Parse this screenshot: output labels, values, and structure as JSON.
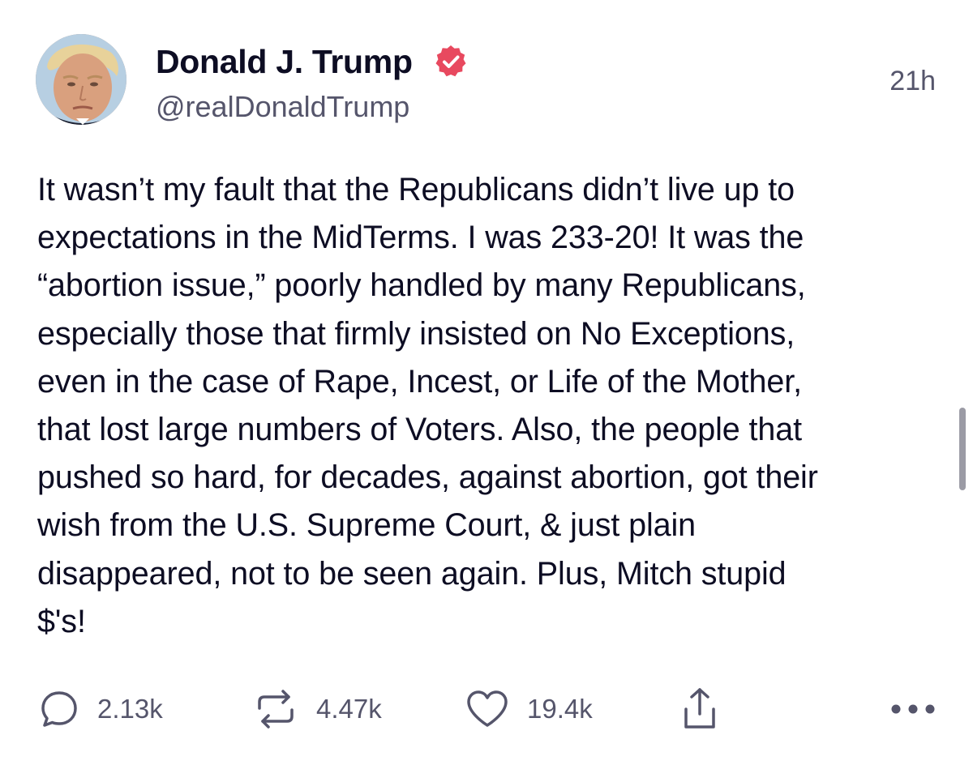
{
  "author": {
    "display_name": "Donald J. Trump",
    "handle": "@realDonaldTrump",
    "verified": true,
    "avatar_icon": "profile-photo"
  },
  "timestamp": "21h",
  "body": "It wasn’t my fault that the Republicans didn’t live up to\nexpectations in the MidTerms. I was 233-20! It was the\n“abortion issue,” poorly handled by many Republicans,\nespecially those that firmly insisted on No Exceptions,\neven in the case of Rape, Incest, or Life of the Mother,\nthat lost large numbers of Voters. Also, the people that\npushed so hard, for decades, against abortion, got their\nwish from the U.S. Supreme Court, & just plain\ndisappeared, not to be seen again. Plus, Mitch stupid\n$'s!",
  "actions": {
    "reply": {
      "icon": "reply-bubble-icon",
      "count": "2.13k"
    },
    "repost": {
      "icon": "repost-arrows-icon",
      "count": "4.47k"
    },
    "like": {
      "icon": "heart-icon",
      "count": "19.4k"
    },
    "share": {
      "icon": "share-upload-icon"
    },
    "more": {
      "icon": "more-dots-icon"
    }
  },
  "colors": {
    "text_primary": "#0d0d23",
    "text_secondary": "#55556b",
    "verified_badge": "#e8495f",
    "background": "#ffffff"
  }
}
